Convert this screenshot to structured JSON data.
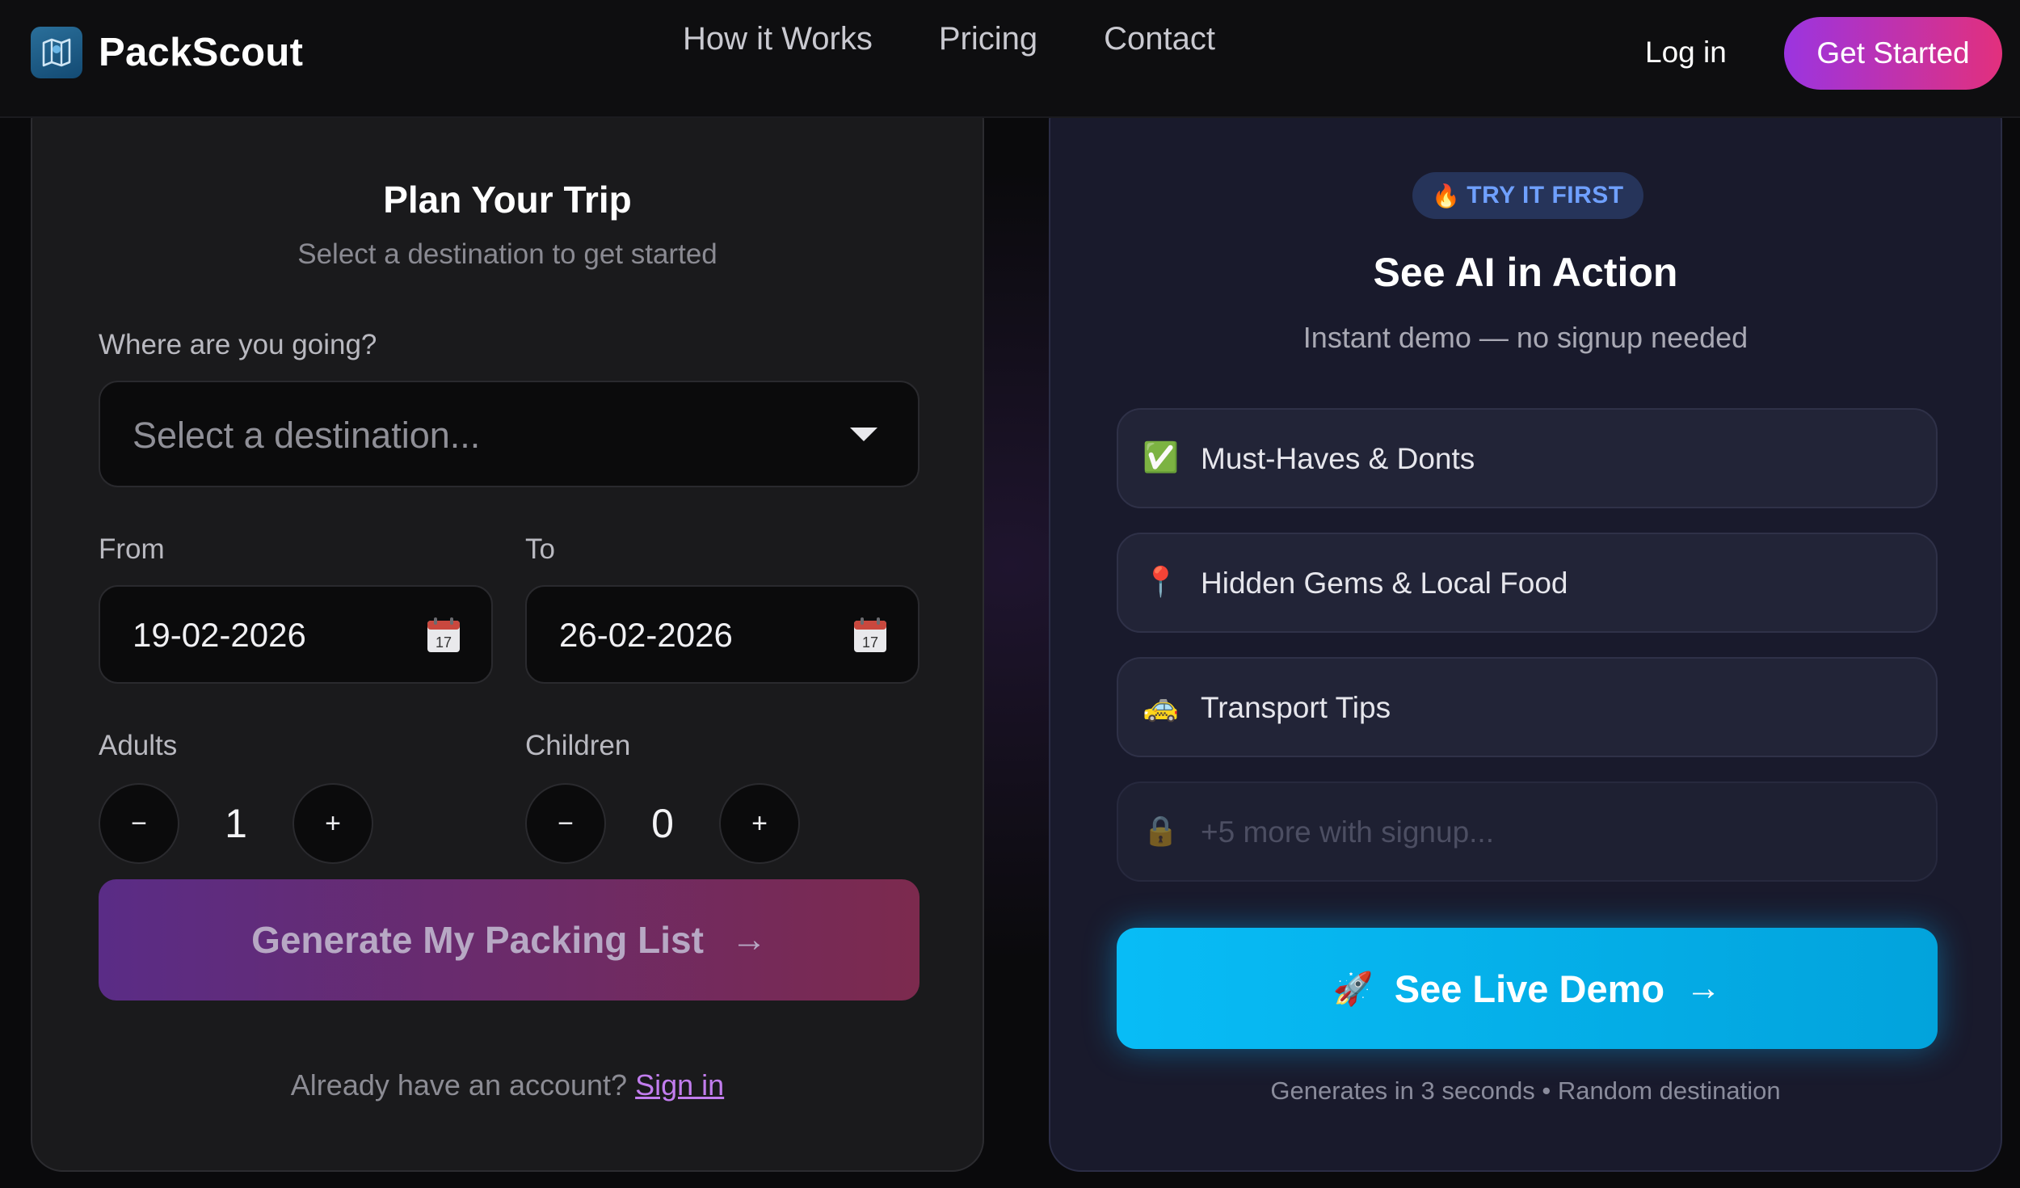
{
  "nav": {
    "brand": "PackScout",
    "links": [
      "How it Works",
      "Pricing",
      "Contact"
    ],
    "login": "Log in",
    "get_started": "Get Started"
  },
  "plan": {
    "title": "Plan Your Trip",
    "subtitle": "Select a destination to get started",
    "destination_label": "Where are you going?",
    "destination_placeholder": "Select a destination...",
    "from_label": "From",
    "from_value": "19-02-2026",
    "to_label": "To",
    "to_value": "26-02-2026",
    "adults_label": "Adults",
    "adults_value": "1",
    "children_label": "Children",
    "children_value": "0",
    "minus": "−",
    "plus": "+",
    "generate_label": "Generate My Packing List",
    "arrow": "→",
    "account_text": "Already have an account?",
    "sign_in": "Sign in"
  },
  "demo": {
    "badge": "TRY IT FIRST",
    "badge_icon": "🔥",
    "title": "See AI in Action",
    "subtitle": "Instant demo — no signup needed",
    "features": [
      {
        "icon": "✅",
        "label": "Must-Haves & Donts"
      },
      {
        "icon": "📍",
        "label": "Hidden Gems & Local Food"
      },
      {
        "icon": "🚕",
        "label": "Transport Tips"
      },
      {
        "icon": "🔒",
        "label": "+5 more with signup..."
      }
    ],
    "button_icon": "🚀",
    "button_label": "See Live Demo",
    "button_arrow": "→",
    "note": "Generates in 3 seconds • Random destination"
  },
  "colors": {
    "accent_purple": "#9b34e0",
    "accent_pink": "#e2307d",
    "demo_blue": "#08bcf6",
    "sign_in_link": "#c27dee",
    "badge_text": "#6fa0ff"
  }
}
